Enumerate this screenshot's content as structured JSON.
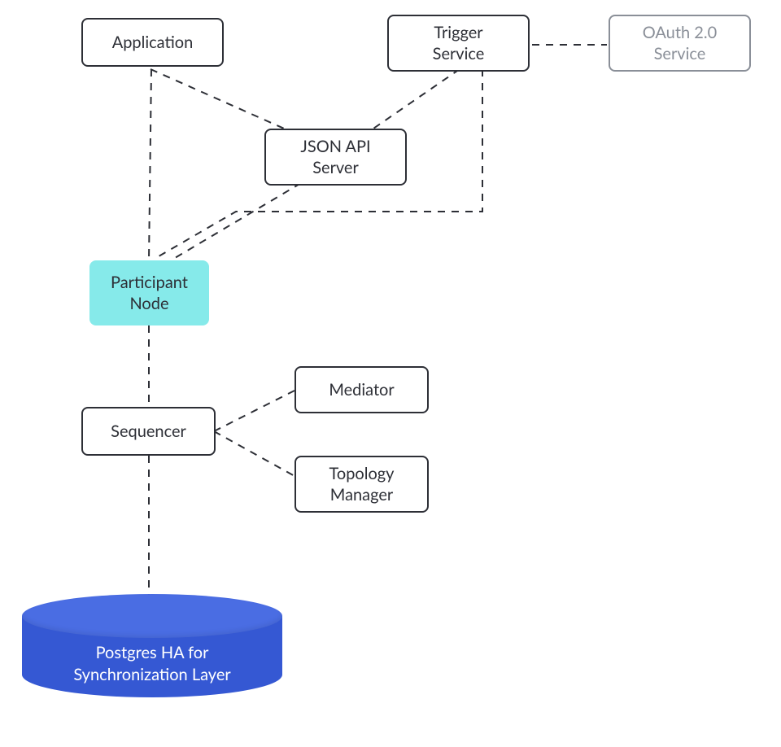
{
  "nodes": {
    "application": "Application",
    "trigger_service": "Trigger\nService",
    "oauth_service": "OAuth 2.0\nService",
    "json_api": "JSON API\nServer",
    "participant_node": "Participant\nNode",
    "sequencer": "Sequencer",
    "mediator": "Mediator",
    "topology_manager": "Topology\nManager",
    "postgres": "Postgres HA for\nSynchronization Layer"
  }
}
